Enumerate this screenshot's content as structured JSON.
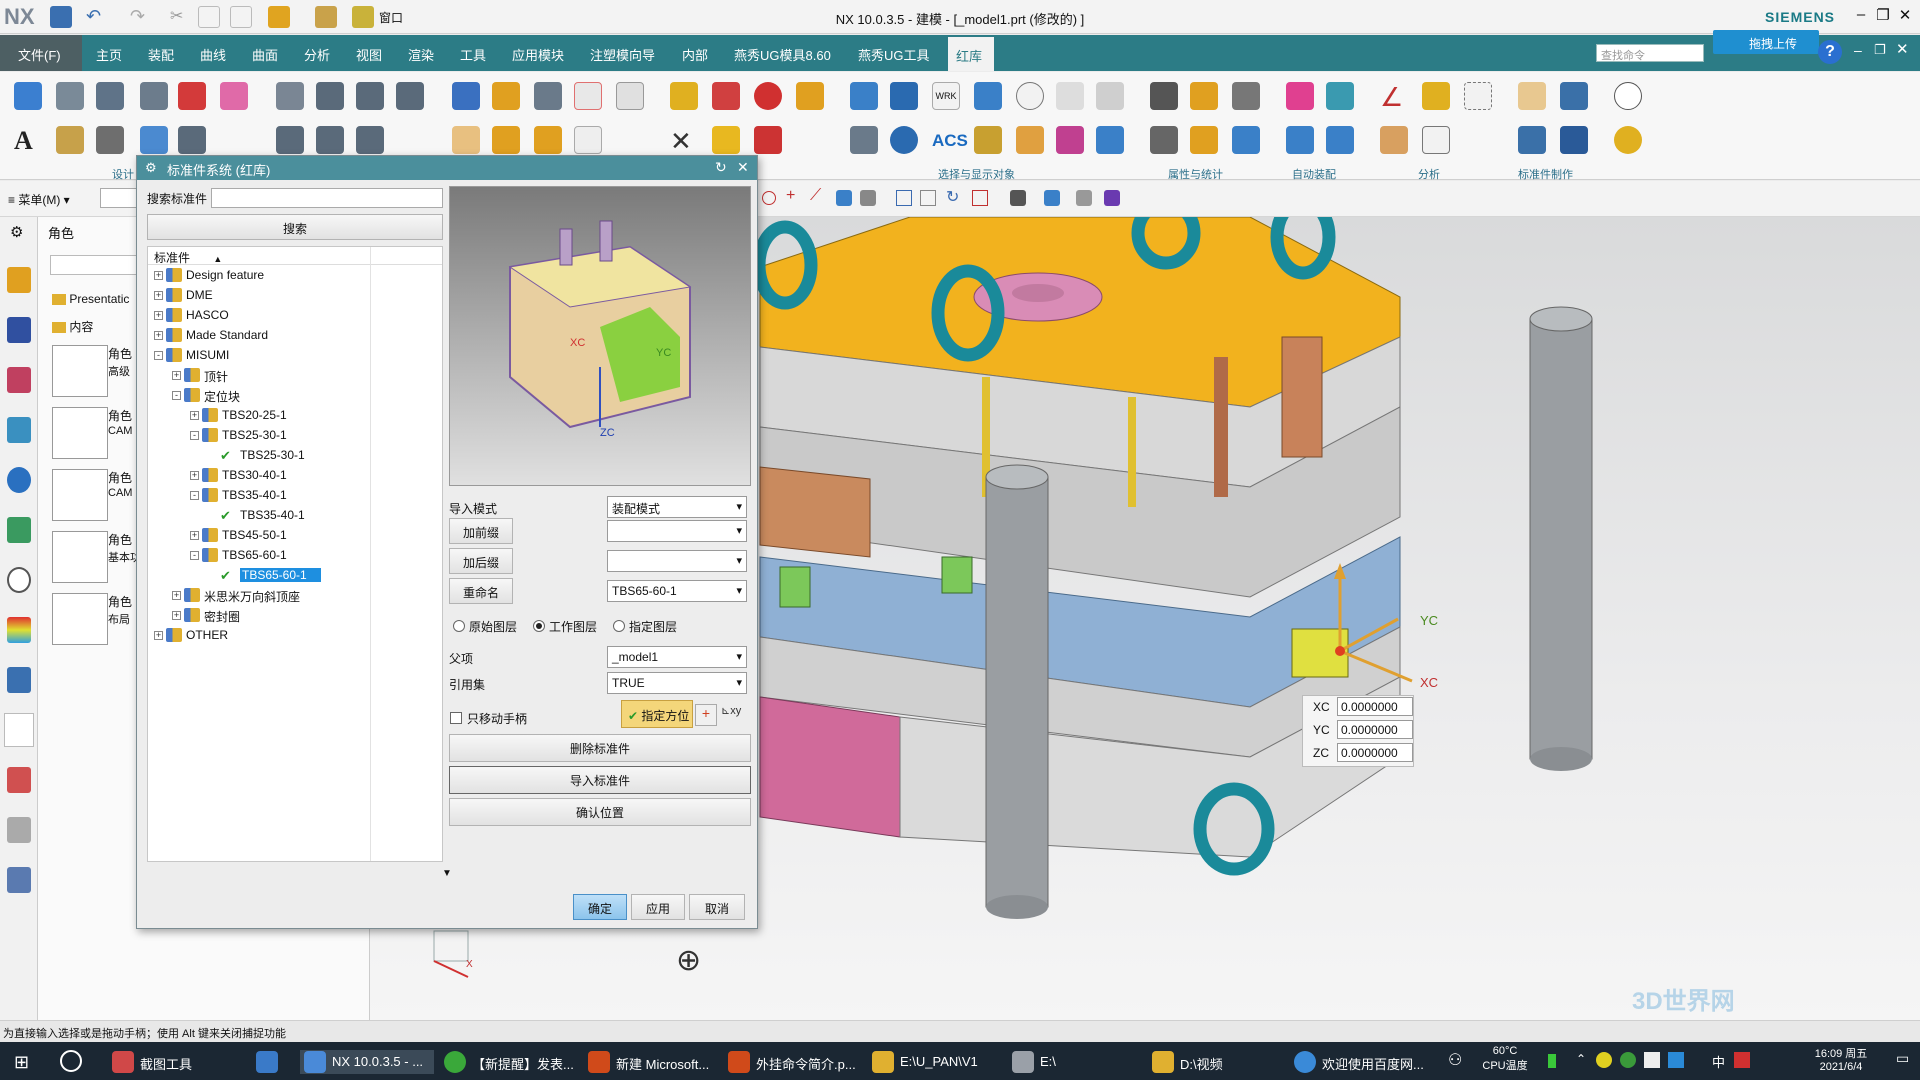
{
  "window": {
    "app_logo": "NX",
    "title": "NX 10.0.3.5 - 建模 - [_model1.prt  (修改的) ]",
    "brand": "SIEMENS",
    "window_menu": "窗口"
  },
  "menubar": {
    "file": "文件(F)",
    "items": [
      "主页",
      "装配",
      "曲线",
      "曲面",
      "分析",
      "视图",
      "渲染",
      "工具",
      "应用模块",
      "注塑模向导",
      "内部",
      "燕秀UG模具8.60",
      "燕秀UG工具",
      "红库"
    ],
    "command_search_placeholder": "查找命令",
    "upload_button": "拖拽上传"
  },
  "ribbon": {
    "groups": [
      "设计",
      "选择与显示对象",
      "属性与统计",
      "自动装配",
      "分析",
      "标准件制作"
    ],
    "menu_button": "菜单(M)"
  },
  "nav_panel": {
    "title": "角色",
    "folders": [
      "Presentatic",
      "内容"
    ],
    "roles": [
      {
        "name": "角色",
        "sub": "高级"
      },
      {
        "name": "角色",
        "sub": "CAM"
      },
      {
        "name": "角色",
        "sub": "CAM"
      },
      {
        "name": "角色",
        "sub": "基本功"
      },
      {
        "name": "角色",
        "sub": "布局"
      }
    ]
  },
  "dialog": {
    "title": "标准件系统 (红库)",
    "search_label": "搜索标准件",
    "search_value": "",
    "search_button": "搜索",
    "tree_header": "标准件",
    "tree": [
      {
        "label": "Design feature",
        "toggle": "+",
        "depth": 0,
        "check": false
      },
      {
        "label": "DME",
        "toggle": "+",
        "depth": 0,
        "check": false
      },
      {
        "label": "HASCO",
        "toggle": "+",
        "depth": 0,
        "check": false
      },
      {
        "label": "Made Standard",
        "toggle": "+",
        "depth": 0,
        "check": false
      },
      {
        "label": "MISUMI",
        "toggle": "-",
        "depth": 0,
        "check": false
      },
      {
        "label": "顶针",
        "toggle": "+",
        "depth": 1,
        "check": false
      },
      {
        "label": "定位块",
        "toggle": "-",
        "depth": 1,
        "check": false
      },
      {
        "label": "TBS20-25-1",
        "toggle": "+",
        "depth": 2,
        "check": false
      },
      {
        "label": "TBS25-30-1",
        "toggle": "-",
        "depth": 2,
        "check": false
      },
      {
        "label": "TBS25-30-1",
        "toggle": "",
        "depth": 3,
        "check": true
      },
      {
        "label": "TBS30-40-1",
        "toggle": "+",
        "depth": 2,
        "check": false
      },
      {
        "label": "TBS35-40-1",
        "toggle": "-",
        "depth": 2,
        "check": false
      },
      {
        "label": "TBS35-40-1",
        "toggle": "",
        "depth": 3,
        "check": true
      },
      {
        "label": "TBS45-50-1",
        "toggle": "+",
        "depth": 2,
        "check": false
      },
      {
        "label": "TBS65-60-1",
        "toggle": "-",
        "depth": 2,
        "check": false
      },
      {
        "label": "TBS65-60-1",
        "toggle": "",
        "depth": 3,
        "check": true,
        "selected": true
      },
      {
        "label": "米思米万向斜顶座",
        "toggle": "+",
        "depth": 1,
        "check": false
      },
      {
        "label": "密封圈",
        "toggle": "+",
        "depth": 1,
        "check": false
      },
      {
        "label": "OTHER",
        "toggle": "+",
        "depth": 0,
        "check": false
      }
    ],
    "preview_labels": {
      "x": "XC",
      "y": "YC",
      "z": "ZC"
    },
    "import_mode_label": "导入模式",
    "import_mode_value": "装配模式",
    "prefix_button": "加前缀",
    "prefix_value": "",
    "suffix_button": "加后缀",
    "suffix_value": "",
    "rename_button": "重命名",
    "rename_value": "TBS65-60-1",
    "layers": [
      "原始图层",
      "工作图层",
      "指定图层"
    ],
    "layer_selected": "工作图层",
    "parent_label": "父项",
    "parent_value": "_model1",
    "refset_label": "引用集",
    "refset_value": "TRUE",
    "move_handle_label": "只移动手柄",
    "move_handle_checked": false,
    "orient_button": "指定方位",
    "delete_button": "删除标准件",
    "import_button": "导入标准件",
    "confirm_pos_button": "确认位置",
    "ok": "确定",
    "apply": "应用",
    "cancel": "取消"
  },
  "viewport": {
    "coords": [
      {
        "label": "XC",
        "value": "0.0000000"
      },
      {
        "label": "YC",
        "value": "0.0000000"
      },
      {
        "label": "ZC",
        "value": "0.0000000"
      }
    ],
    "axis_labels": {
      "x": "XC",
      "y": "YC"
    },
    "view_triad_label": "X"
  },
  "status_bar": "为直接输入选择或是拖动手柄；使用 Alt 键来关闭捕捉功能",
  "taskbar": {
    "items": [
      "截图工具",
      "",
      "NX 10.0.3.5 - ...",
      "【新提醒】发表...",
      "新建 Microsoft...",
      "外挂命令简介.p...",
      "E:\\U_PAN\\V1",
      "E:\\",
      "D:\\视频",
      "欢迎使用百度网..."
    ],
    "temp": "60°C",
    "temp_label": "CPU温度",
    "ime": "中",
    "clock_time": "16:09 周五",
    "clock_date": "2021/6/4"
  },
  "watermark": "3D世界网"
}
